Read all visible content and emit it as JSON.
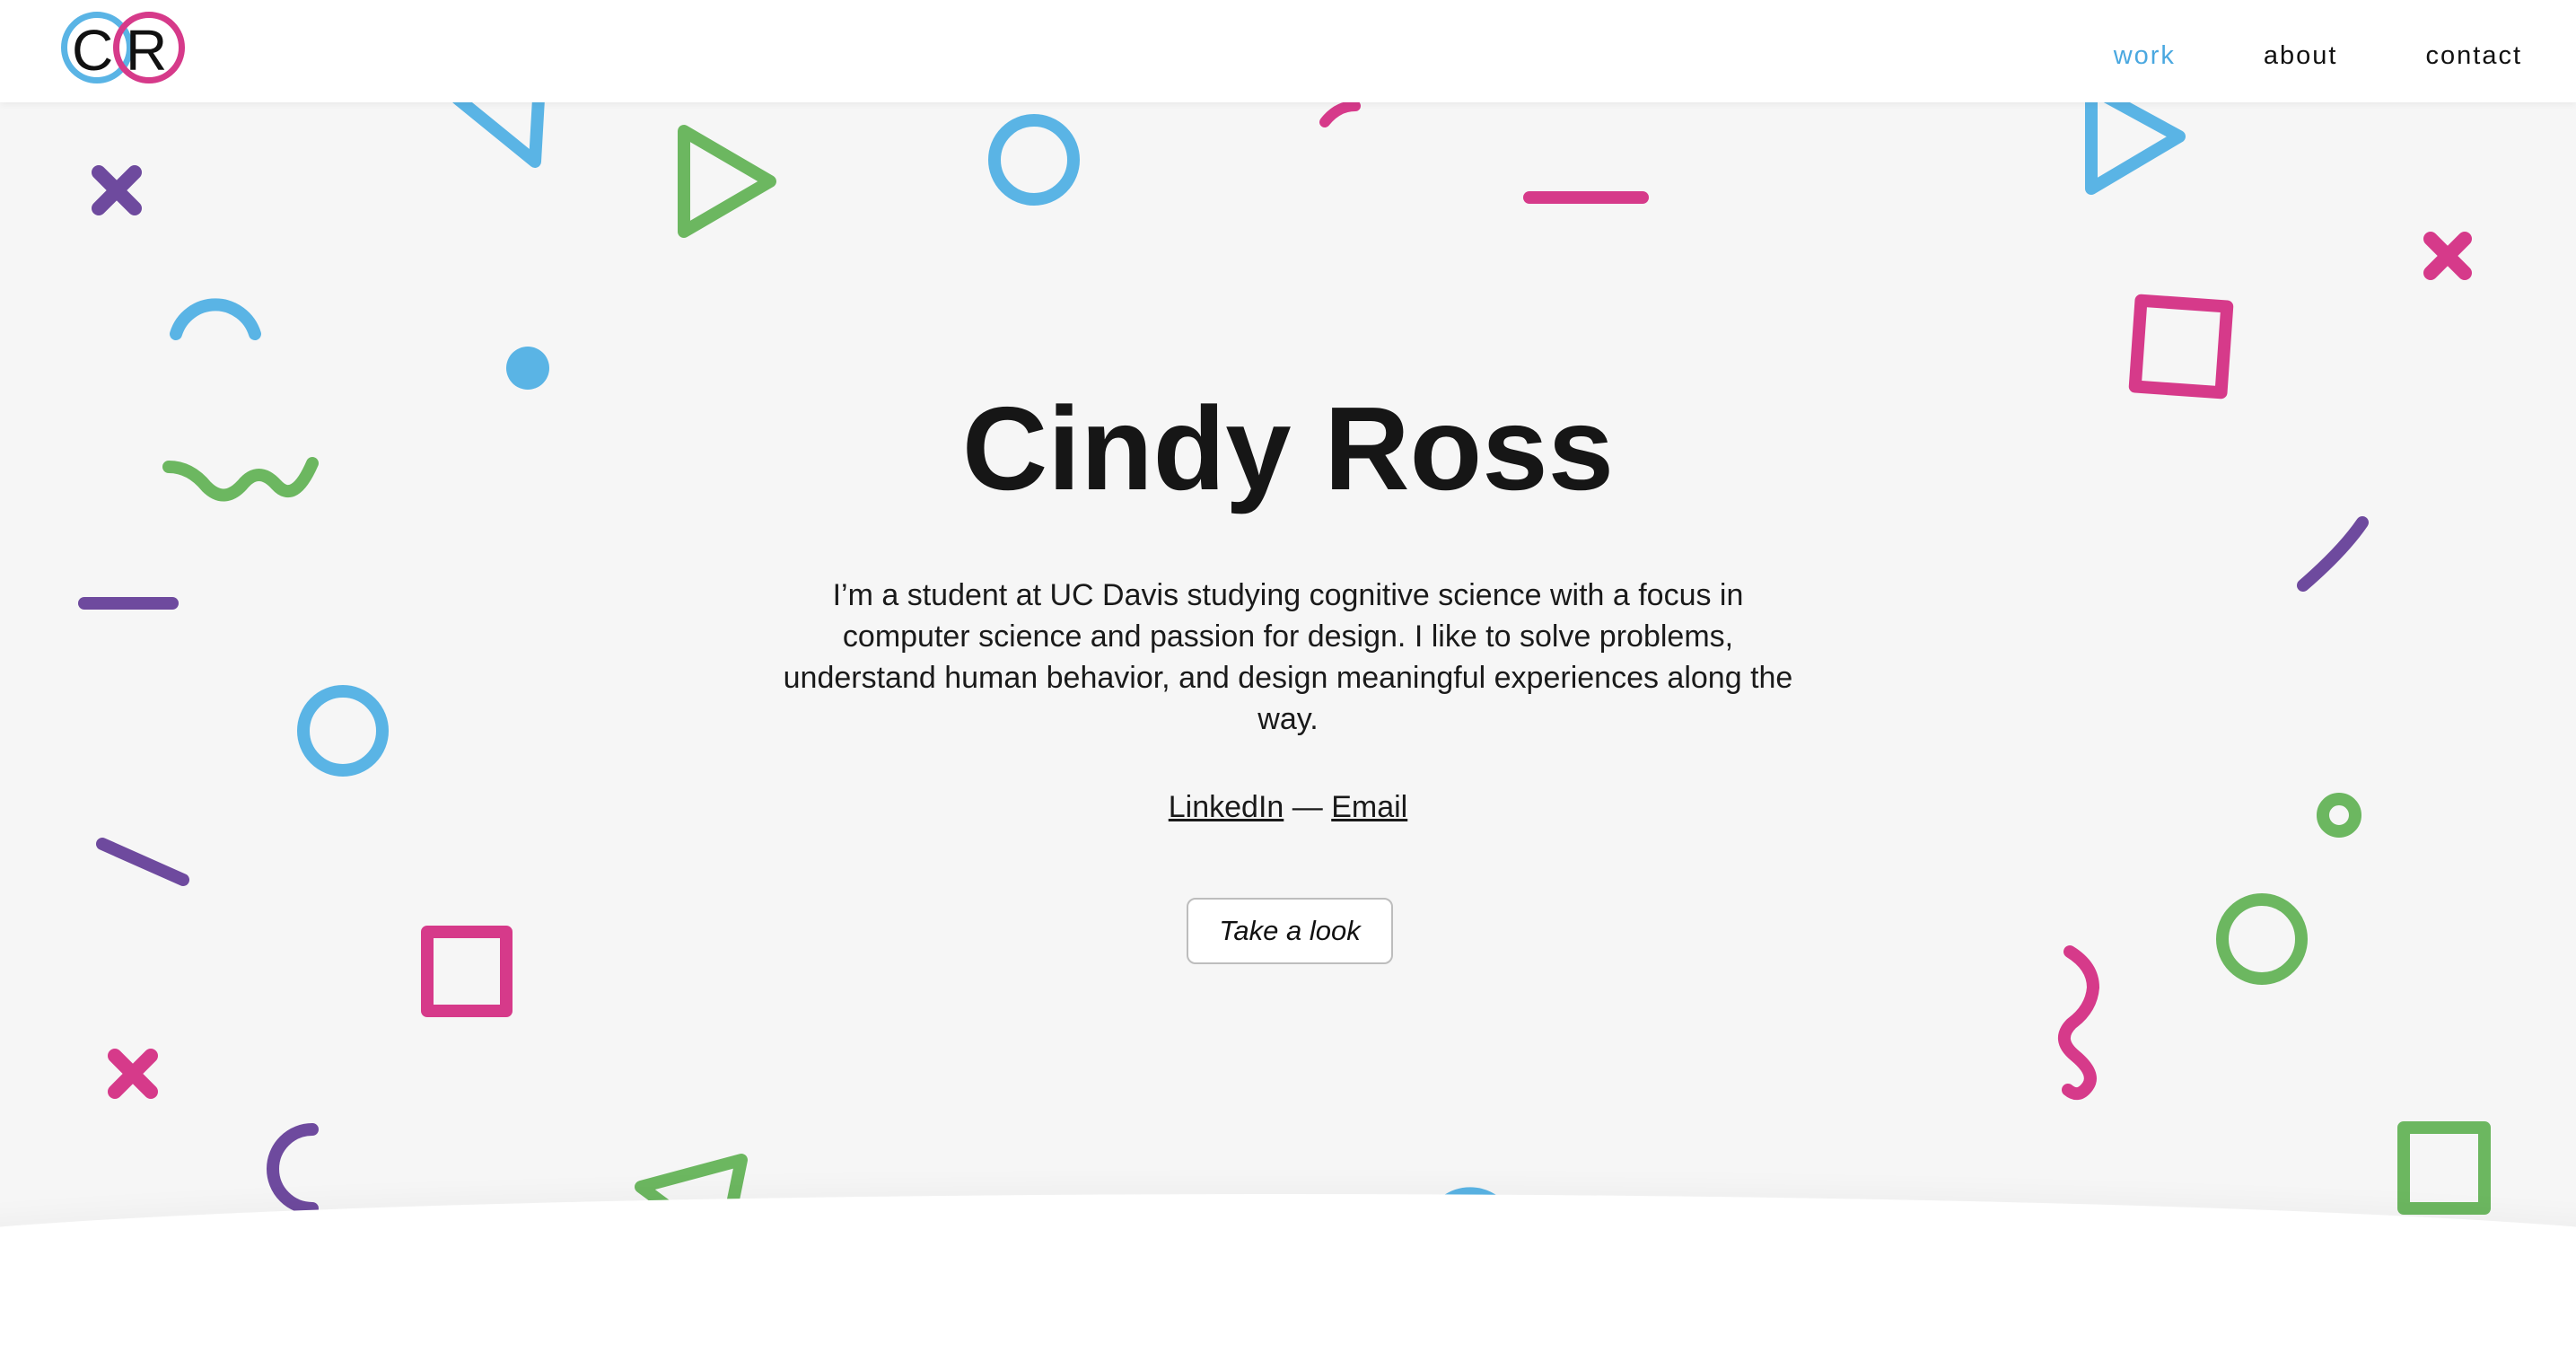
{
  "header": {
    "logo_letters": [
      "C",
      "R"
    ],
    "nav": [
      {
        "label": "work",
        "active": true
      },
      {
        "label": "about",
        "active": false
      },
      {
        "label": "contact",
        "active": false
      }
    ]
  },
  "hero": {
    "title": "Cindy Ross",
    "bio": "I’m a student at UC Davis studying cognitive science with a focus in computer science and passion for design. I like to solve problems, understand human behavior, and design meaningful experiences along the way.",
    "links": {
      "linkedin": "LinkedIn",
      "separator": "—",
      "email": "Email"
    },
    "cta_label": "Take a look"
  },
  "colors": {
    "blue": "#5ab4e5",
    "pink": "#d63a8a",
    "green": "#6cb760",
    "purple": "#6e4a9e",
    "nav_active": "#4aa8e0"
  }
}
